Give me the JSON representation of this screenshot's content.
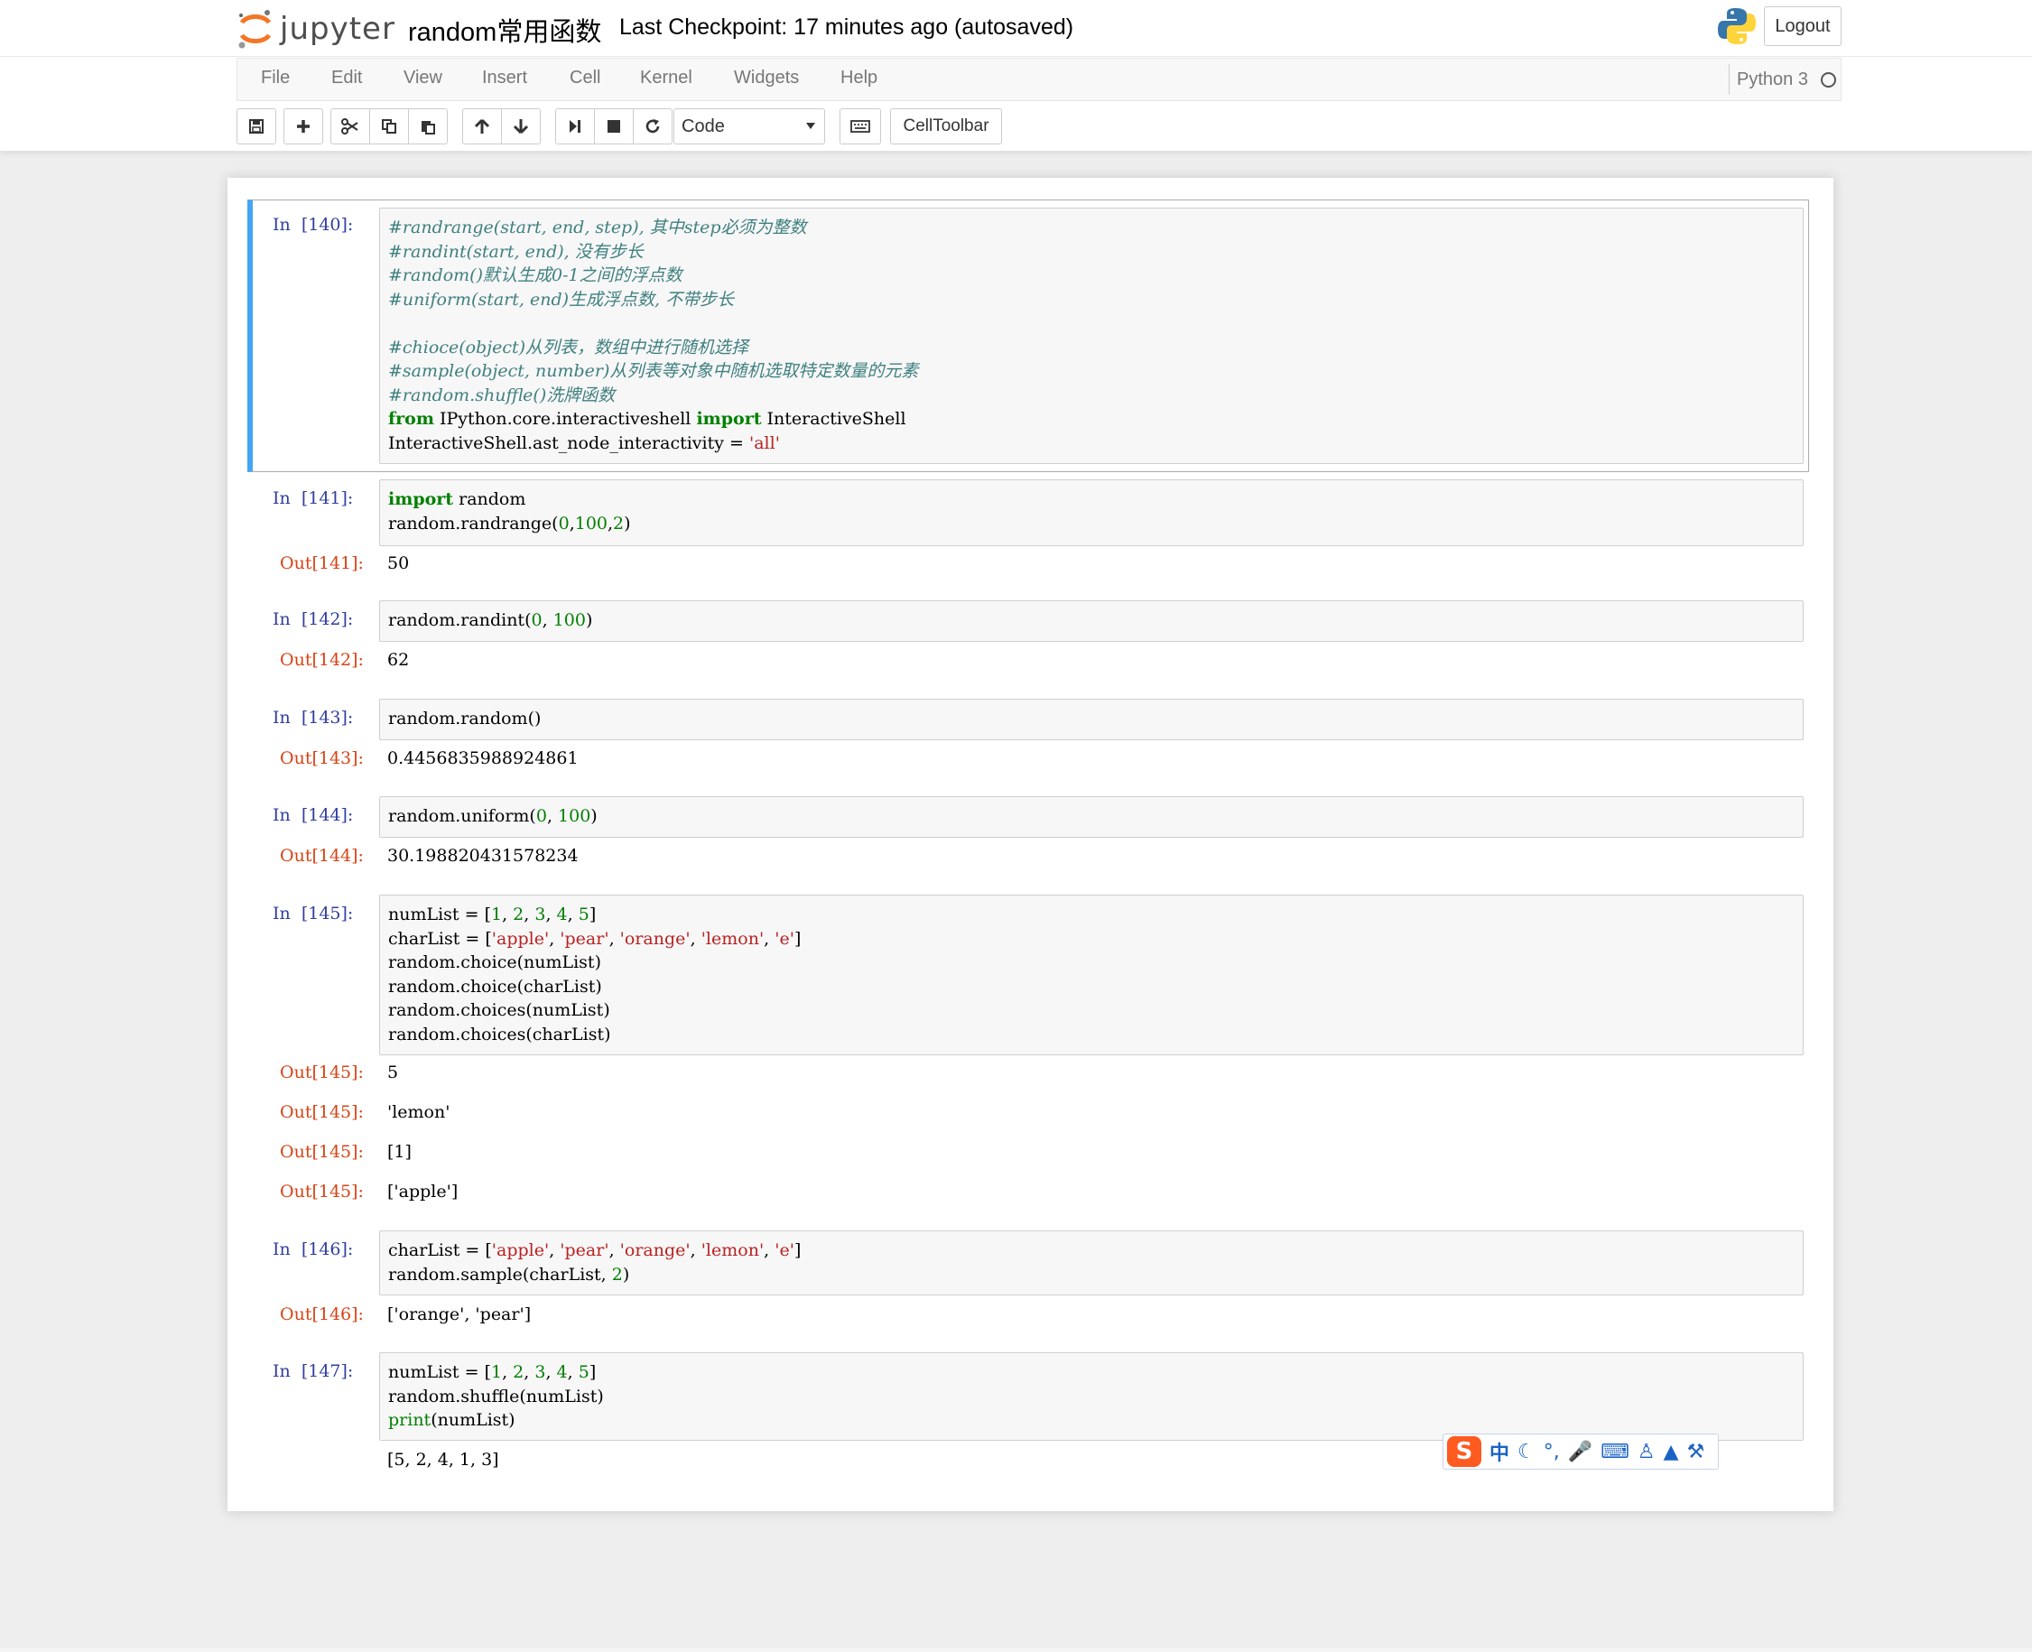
{
  "header": {
    "logo_text": "jupyter",
    "notebook_name": "random常用函数",
    "checkpoint": "Last Checkpoint: 17 minutes ago (autosaved)",
    "logout_label": "Logout"
  },
  "menubar": {
    "items": [
      "File",
      "Edit",
      "View",
      "Insert",
      "Cell",
      "Kernel",
      "Widgets",
      "Help"
    ],
    "kernel_name": "Python 3"
  },
  "toolbar": {
    "icons": [
      "save-icon",
      "plus-icon",
      "cut-icon",
      "copy-icon",
      "paste-icon",
      "arrow-up-icon",
      "arrow-down-icon",
      "run-icon",
      "stop-icon",
      "restart-icon",
      "keyboard-icon"
    ],
    "cell_type": "Code",
    "celltoolbar_label": "CellToolbar"
  },
  "cells": [
    {
      "in_prompt": "In  [140]:",
      "lines": [
        "#randrange(start, end, step), 其中step必须为整数",
        "#randint(start, end), 没有步长",
        "#random()默认生成0-1之间的浮点数",
        "#uniform(start, end)生成浮点数, 不带步长",
        "",
        "#chioce(object)从列表，数组中进行随机选择",
        "#sample(object, number)从列表等对象中随机选取特定数量的元素",
        "#random.shuffle()洗牌函数",
        "from IPython.core.interactiveshell import InteractiveShell",
        "InteractiveShell.ast_node_interactivity = 'all'"
      ],
      "outputs": []
    },
    {
      "in_prompt": "In  [141]:",
      "lines": [
        "import random",
        "random.randrange(0,100,2)"
      ],
      "outputs": [
        {
          "prompt": "Out[141]:",
          "text": "50"
        }
      ]
    },
    {
      "in_prompt": "In  [142]:",
      "lines": [
        "random.randint(0, 100)"
      ],
      "outputs": [
        {
          "prompt": "Out[142]:",
          "text": "62"
        }
      ]
    },
    {
      "in_prompt": "In  [143]:",
      "lines": [
        "random.random()"
      ],
      "outputs": [
        {
          "prompt": "Out[143]:",
          "text": "0.4456835988924861"
        }
      ]
    },
    {
      "in_prompt": "In  [144]:",
      "lines": [
        "random.uniform(0, 100)"
      ],
      "outputs": [
        {
          "prompt": "Out[144]:",
          "text": "30.198820431578234"
        }
      ]
    },
    {
      "in_prompt": "In  [145]:",
      "lines": [
        "numList = [1, 2, 3, 4, 5]",
        "charList = ['apple', 'pear', 'orange', 'lemon', 'e']",
        "random.choice(numList)",
        "random.choice(charList)",
        "random.choices(numList)",
        "random.choices(charList)"
      ],
      "outputs": [
        {
          "prompt": "Out[145]:",
          "text": "5"
        },
        {
          "prompt": "Out[145]:",
          "text": "'lemon'"
        },
        {
          "prompt": "Out[145]:",
          "text": "[1]"
        },
        {
          "prompt": "Out[145]:",
          "text": "['apple']"
        }
      ]
    },
    {
      "in_prompt": "In  [146]:",
      "lines": [
        "charList = ['apple', 'pear', 'orange', 'lemon', 'e']",
        "random.sample(charList, 2)"
      ],
      "outputs": [
        {
          "prompt": "Out[146]:",
          "text": "['orange', 'pear']"
        }
      ]
    },
    {
      "in_prompt": "In  [147]:",
      "lines": [
        "numList = [1, 2, 3, 4, 5]",
        "random.shuffle(numList)",
        "print(numList)"
      ],
      "outputs": [
        {
          "prompt": "",
          "text": "[5, 2, 4, 1, 3]"
        }
      ]
    }
  ],
  "ime_toolbar": {
    "logo": "S",
    "mode": "中",
    "icons": [
      "moon-icon",
      "punctuation-icon",
      "microphone-icon",
      "keyboard-icon",
      "user-icon",
      "shirt-icon",
      "wrench-icon"
    ]
  },
  "colors": {
    "selected_cell_border": "#42a5f5",
    "in_prompt": "#303f9f",
    "out_prompt": "#d84315",
    "comment": "#408080",
    "keyword": "#008000",
    "string": "#ba2121"
  }
}
